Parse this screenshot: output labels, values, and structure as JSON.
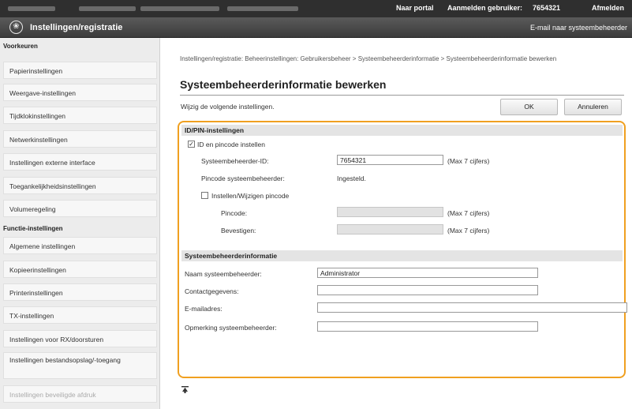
{
  "topbar": {
    "portal_link": "Naar portal",
    "login_label": "Aanmelden gebruiker:",
    "user_id": "7654321",
    "logout_link": "Afmelden"
  },
  "header": {
    "app_title": "Instellingen/registratie",
    "mail_link": "E-mail naar systeembeheerder"
  },
  "sidebar": {
    "section_preferences": "Voorkeuren",
    "section_functions": "Functie-instellingen",
    "items": [
      {
        "label": "Papierinstellingen"
      },
      {
        "label": "Weergave-instellingen"
      },
      {
        "label": "Tijdklokinstellingen"
      },
      {
        "label": "Netwerkinstellingen"
      },
      {
        "label": "Instellingen externe interface"
      },
      {
        "label": "Toegankelijkheidsinstellingen"
      },
      {
        "label": "Volumeregeling"
      }
    ],
    "function_items": [
      {
        "label": "Algemene instellingen"
      },
      {
        "label": "Kopieerinstellingen"
      },
      {
        "label": "Printerinstellingen"
      },
      {
        "label": "TX-instellingen"
      },
      {
        "label": "Instellingen voor RX/doorsturen"
      },
      {
        "label": "Instellingen bestandsopslag/-toegang"
      },
      {
        "label": "Instellingen beveiligde afdruk"
      }
    ]
  },
  "main": {
    "breadcrumb": "Instellingen/registratie: Beheerinstellingen: Gebruikersbeheer > Systeembeheerderinformatie > Systeembeheerderinformatie bewerken",
    "title": "Systeembeheerderinformatie bewerken",
    "intro": "Wijzig de volgende instellingen.",
    "ok_button": "OK",
    "cancel_button": "Annuleren",
    "idpin": {
      "heading": "ID/PIN-instellingen",
      "set_id_pin_checkbox": "ID en pincode instellen",
      "set_id_pin_checked": true,
      "admin_id_label": "Systeembeheerder-ID:",
      "admin_id_value": "7654321",
      "admin_id_hint": "(Max 7 cijfers)",
      "admin_pin_label": "Pincode systeembeheerder:",
      "admin_pin_status": "Ingesteld.",
      "change_pin_checkbox": "Instellen/Wijzigen pincode",
      "change_pin_checked": false,
      "pin_label": "Pincode:",
      "pin_hint": "(Max 7 cijfers)",
      "confirm_label": "Bevestigen:",
      "confirm_hint": "(Max 7 cijfers)"
    },
    "admin_info": {
      "heading": "Systeembeheerderinformatie",
      "name_label": "Naam systeembeheerder:",
      "name_value": "Administrator",
      "contact_label": "Contactgegevens:",
      "contact_value": "",
      "email_label": "E-mailadres:",
      "email_value": "",
      "comment_label": "Opmerking systeembeheerder:",
      "comment_value": ""
    }
  },
  "colors": {
    "highlight": "#f0a020",
    "topbar": "#2f2f2f",
    "titlebar": "#4a4a4a"
  }
}
